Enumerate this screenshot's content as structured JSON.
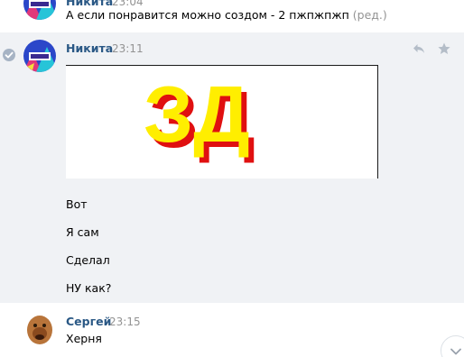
{
  "messages": {
    "top": {
      "author": "Никита",
      "time": "23:04",
      "text": "А если понравится можно создом - 2 пжпжпжп",
      "edited": "(ред.)"
    },
    "active": {
      "author": "Никита",
      "time": "23:11",
      "image_text": "ЗД",
      "lines": [
        "Вот",
        "Я сам",
        "Сделал",
        "НУ как?"
      ]
    },
    "bottom": {
      "author": "Сергей",
      "time": "23:15",
      "text": "Херня"
    }
  },
  "icons": {
    "read": "check-circle-icon",
    "reply": "reply-icon",
    "favorite": "star-icon",
    "scroll": "chevron-down-icon"
  },
  "colors": {
    "author": "#2a5885",
    "time": "#939393",
    "highlight_bg": "#f0f2f5",
    "image_text_fill": "#ffee00",
    "image_text_shadow": "#e01010"
  }
}
